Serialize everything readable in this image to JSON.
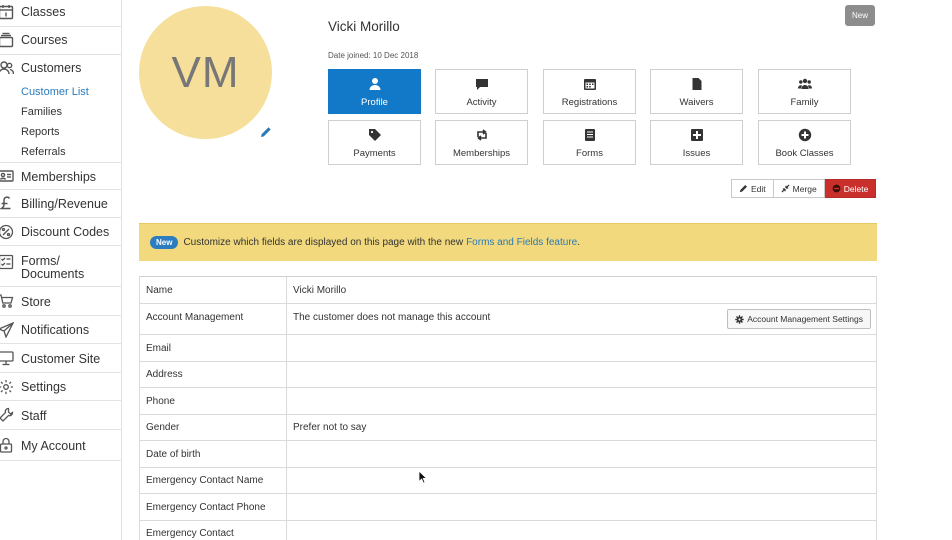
{
  "sidebar": {
    "items": [
      {
        "label": "Classes",
        "icon": "calendar-icon"
      },
      {
        "label": "Courses",
        "icon": "layers-icon"
      },
      {
        "label": "Customers",
        "icon": "people-icon"
      },
      {
        "label": "Memberships",
        "icon": "id-card-icon"
      },
      {
        "label": "Billing/Revenue",
        "icon": "pound-icon"
      },
      {
        "label": "Discount Codes",
        "icon": "discount-icon"
      },
      {
        "label": "Forms/\nDocuments",
        "label_line1": "Forms/",
        "label_line2": "Documents",
        "icon": "checklist-icon"
      },
      {
        "label": "Store",
        "icon": "cart-icon"
      },
      {
        "label": "Notifications",
        "icon": "paper-plane-icon"
      },
      {
        "label": "Customer Site",
        "icon": "monitor-icon"
      },
      {
        "label": "Settings",
        "icon": "gear-icon"
      },
      {
        "label": "Staff",
        "icon": "tools-icon"
      },
      {
        "label": "My Account",
        "icon": "lock-icon"
      }
    ],
    "customer_subitems": [
      {
        "label": "Customer List",
        "active": true
      },
      {
        "label": "Families",
        "active": false
      },
      {
        "label": "Reports",
        "active": false
      },
      {
        "label": "Referrals",
        "active": false
      }
    ]
  },
  "profile": {
    "initials": "VM",
    "name": "Vicki Morillo",
    "date_joined": "Date joined: 10 Dec 2018",
    "new_badge": "New",
    "avatar_color": "#f6df9a"
  },
  "tiles": [
    {
      "label": "Profile",
      "icon": "user-icon",
      "active": true
    },
    {
      "label": "Activity",
      "icon": "speech-bubble-icon"
    },
    {
      "label": "Registrations",
      "icon": "calendar-icon"
    },
    {
      "label": "Waivers",
      "icon": "document-icon"
    },
    {
      "label": "Family",
      "icon": "group-icon"
    },
    {
      "label": "Payments",
      "icon": "tag-icon"
    },
    {
      "label": "Memberships",
      "icon": "retweet-icon"
    },
    {
      "label": "Forms",
      "icon": "list-document-icon"
    },
    {
      "label": "Issues",
      "icon": "plus-square-icon"
    },
    {
      "label": "Book Classes",
      "icon": "plus-circle-icon"
    }
  ],
  "actions": {
    "edit": "Edit",
    "merge": "Merge",
    "delete": "Delete"
  },
  "banner": {
    "pill": "New",
    "text": "Customize which fields are displayed on this page with the new",
    "link": "Forms and Fields feature",
    "suffix": "."
  },
  "details": {
    "rows": [
      {
        "key": "Name",
        "value": "Vicki Morillo"
      },
      {
        "key": "Account Management",
        "value": "The customer does not manage this account",
        "button": "Account Management Settings"
      },
      {
        "key": "Email",
        "value": ""
      },
      {
        "key": "Address",
        "value": ""
      },
      {
        "key": "Phone",
        "value": ""
      },
      {
        "key": "Gender",
        "value": "Prefer not to say"
      },
      {
        "key": "Date of birth",
        "value": ""
      },
      {
        "key": "Emergency Contact Name",
        "value": ""
      },
      {
        "key": "Emergency Contact Phone",
        "value": ""
      },
      {
        "key": "Emergency Contact",
        "value": ""
      }
    ]
  },
  "colors": {
    "primary": "#1279c8",
    "danger": "#c9302c",
    "banner": "#f2d97d",
    "link": "#2a7ab9"
  }
}
